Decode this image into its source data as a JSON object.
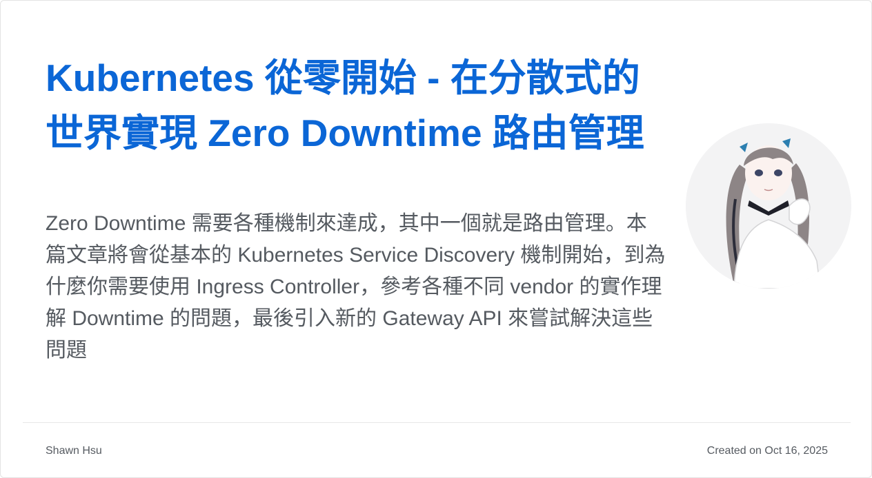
{
  "post": {
    "title": "Kubernetes 從零開始 - 在分散式的世界實現 Zero Downtime 路由管理",
    "description": "Zero Downtime 需要各種機制來達成，其中一個就是路由管理。本篇文章將會從基本的 Kubernetes Service Discovery 機制開始，到為什麼你需要使用 Ingress Controller，參考各種不同 vendor 的實作理解 Downtime 的問題，最後引入新的 Gateway API 來嘗試解決這些問題",
    "avatar_icon": "anime-girl-avatar"
  },
  "footer": {
    "author": "Shawn Hsu",
    "created": "Created on Oct 16, 2025"
  },
  "colors": {
    "title": "#0b66d6",
    "text": "#555a60",
    "divider": "#e8e8e8"
  }
}
